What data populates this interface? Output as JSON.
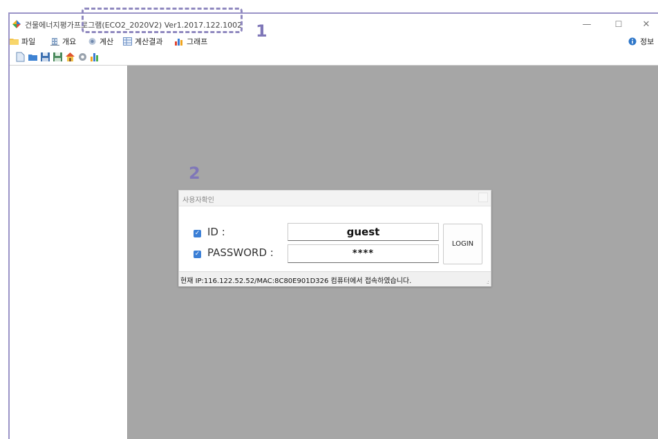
{
  "window": {
    "title": "건물에너지평가프로그램(ECO2_2020V2) Ver1.2017.122.1002",
    "controls": {
      "minimize": "—",
      "maximize": "☐",
      "close": "✕"
    }
  },
  "menu": {
    "items": [
      {
        "label": "파일",
        "icon": "folder-icon"
      },
      {
        "label": "개요",
        "icon": "building-icon"
      },
      {
        "label": "계산",
        "icon": "calculate-icon"
      },
      {
        "label": "계산결과",
        "icon": "table-icon"
      },
      {
        "label": "그래프",
        "icon": "bar-chart-icon"
      }
    ],
    "info": {
      "label": "정보",
      "icon": "info-icon"
    }
  },
  "toolbar": {
    "buttons": [
      "new-file-icon",
      "open-folder-icon",
      "save-icon",
      "save-as-icon",
      "home-icon",
      "settings-gear-icon",
      "chart-icon"
    ]
  },
  "annotations": {
    "one": "1",
    "two": "2"
  },
  "dialog": {
    "title": "사용자확인",
    "id_label": "ID :",
    "id_value": "guest",
    "password_label": "PASSWORD :",
    "password_value": "****",
    "login_label": "LOGIN",
    "status": "현재  IP:116.122.52.52/MAC:8C80E901D326 컴퓨터에서 접속하였습니다."
  },
  "colors": {
    "workspace": "#a6a6a6",
    "accent_checkbox": "#3b7fd6",
    "annotation": "#8f88bf"
  }
}
